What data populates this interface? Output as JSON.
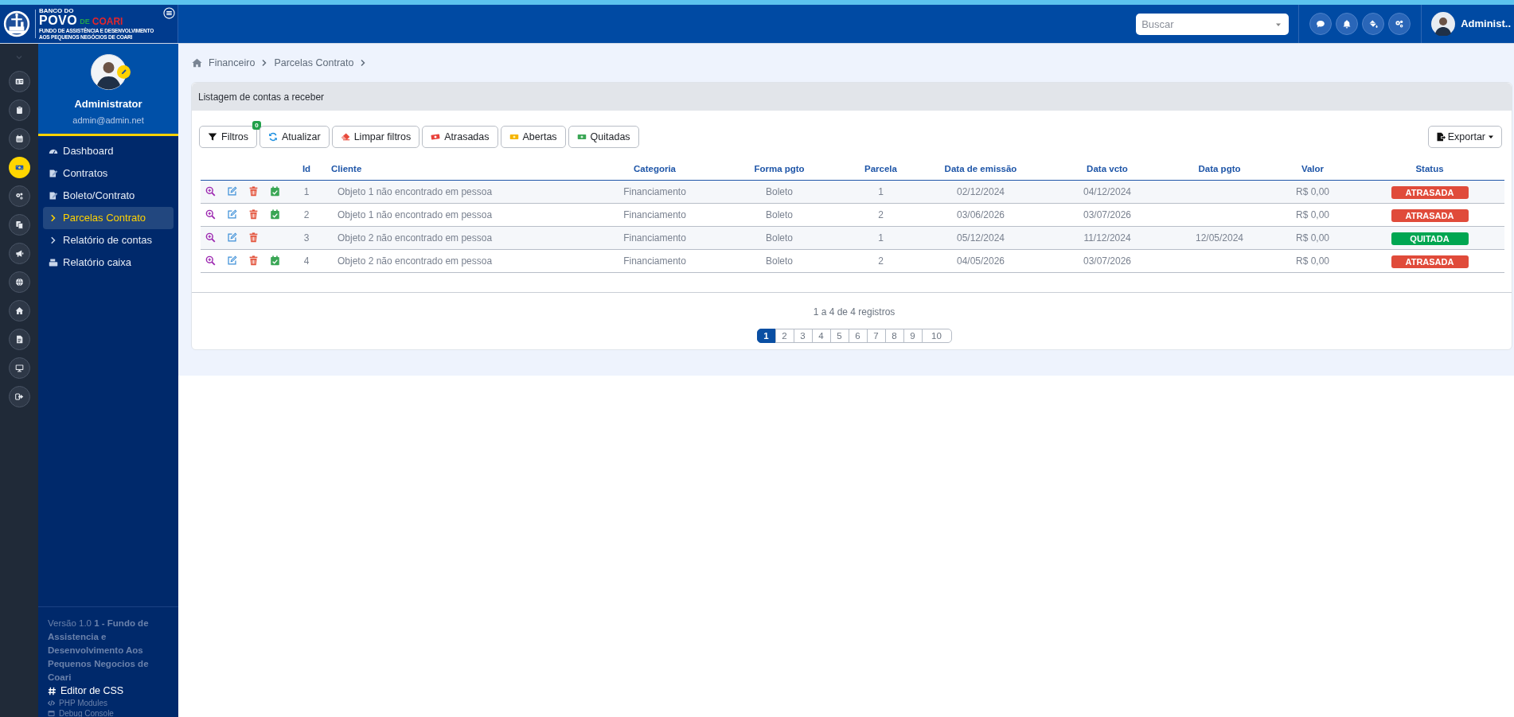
{
  "header": {
    "logo": {
      "top": "BANCO DO",
      "main": "POVO",
      "accent_1": "DE",
      "accent_2": "COARI",
      "sub_1": "FUNDO DE ASSISTÊNCIA E DESENVOLVIMENTO",
      "sub_2": "AOS PEQUENOS NEGÓCIOS DE COARI"
    },
    "search": {
      "placeholder": "Buscar"
    },
    "buttons": [
      {
        "kind": "chat"
      },
      {
        "kind": "bell"
      },
      {
        "kind": "paint"
      },
      {
        "kind": "gears"
      }
    ],
    "user": {
      "name": "Administ.."
    }
  },
  "rail": [
    {
      "kind": "id-card",
      "selected": false
    },
    {
      "kind": "clipboard",
      "selected": false
    },
    {
      "kind": "calendar",
      "selected": false
    },
    {
      "kind": "money",
      "selected": true
    },
    {
      "kind": "gears",
      "selected": false
    },
    {
      "kind": "copy",
      "selected": false
    },
    {
      "kind": "megaphone",
      "selected": false
    },
    {
      "kind": "globe",
      "selected": false
    },
    {
      "kind": "home",
      "selected": false
    },
    {
      "kind": "file",
      "selected": false
    },
    {
      "kind": "monitor",
      "selected": false
    },
    {
      "kind": "sign-out",
      "selected": false
    }
  ],
  "sidebar": {
    "profile": {
      "name": "Administrator",
      "email": "admin@admin.net"
    },
    "items": [
      {
        "kind": "gauge",
        "label": "Dashboard",
        "selected": false
      },
      {
        "kind": "document",
        "label": "Contratos",
        "selected": false
      },
      {
        "kind": "document",
        "label": "Boleto/Contrato",
        "selected": false
      },
      {
        "kind": "chevron",
        "label": "Parcelas Contrato",
        "selected": true
      },
      {
        "kind": "chevron",
        "label": "Relatório de contas",
        "selected": false
      },
      {
        "kind": "register",
        "label": "Relatório caixa",
        "selected": false
      }
    ],
    "footer": {
      "version": "Versão 1.0 **1 - Fundo de Assistencia e Desenvolvimento Aos Pequenos Negocios de Coari**",
      "links": [
        {
          "kind": "hash",
          "label": "Editor de CSS"
        },
        {
          "kind": "code",
          "label": "PHP Modules"
        },
        {
          "kind": "console",
          "label": "Debug Console"
        }
      ]
    }
  },
  "breadcrumb": [
    "Financeiro",
    "Parcelas Contrato"
  ],
  "card": {
    "title": "Listagem de contas a receber",
    "toolbar": [
      {
        "kind": "filter",
        "label": "Filtros",
        "badge": "0"
      },
      {
        "kind": "refresh",
        "label": "Atualizar"
      },
      {
        "kind": "eraser",
        "label": "Limpar filtros"
      },
      {
        "kind": "overdue",
        "label": "Atrasadas"
      },
      {
        "kind": "open",
        "label": "Abertas"
      },
      {
        "kind": "paid",
        "label": "Quitadas"
      }
    ],
    "export": "Exportar",
    "table": {
      "columns": [
        "Id",
        "Cliente",
        "Categoria",
        "Forma pgto",
        "Parcela",
        "Data de emissão",
        "Data vcto",
        "Data pgto",
        "Valor",
        "Status"
      ],
      "rows": [
        {
          "actions": [
            {
              "kind": "view"
            },
            {
              "kind": "edit"
            },
            {
              "kind": "delete"
            },
            {
              "kind": "pay"
            }
          ],
          "cells": [
            "1",
            "Objeto 1 não encontrado em pessoa",
            "Financiamento",
            "Boleto",
            "1",
            "02/12/2024",
            "04/12/2024",
            "",
            "R$ 0,00"
          ],
          "status": {
            "label": "ATRASADA",
            "color": "#e04b3a"
          }
        },
        {
          "actions": [
            {
              "kind": "view"
            },
            {
              "kind": "edit"
            },
            {
              "kind": "delete"
            },
            {
              "kind": "pay"
            }
          ],
          "cells": [
            "2",
            "Objeto 1 não encontrado em pessoa",
            "Financiamento",
            "Boleto",
            "2",
            "03/06/2026",
            "03/07/2026",
            "",
            "R$ 0,00"
          ],
          "status": {
            "label": "ATRASADA",
            "color": "#e04b3a"
          }
        },
        {
          "actions": [
            {
              "kind": "view"
            },
            {
              "kind": "edit"
            },
            {
              "kind": "delete"
            }
          ],
          "cells": [
            "3",
            "Objeto 2 não encontrado em pessoa",
            "Financiamento",
            "Boleto",
            "1",
            "05/12/2024",
            "11/12/2024",
            "12/05/2024",
            "R$ 0,00"
          ],
          "status": {
            "label": "QUITADA",
            "color": "#00a651"
          }
        },
        {
          "actions": [
            {
              "kind": "view"
            },
            {
              "kind": "edit"
            },
            {
              "kind": "delete"
            },
            {
              "kind": "pay"
            }
          ],
          "cells": [
            "4",
            "Objeto 2 não encontrado em pessoa",
            "Financiamento",
            "Boleto",
            "2",
            "04/05/2026",
            "03/07/2026",
            "",
            "R$ 0,00"
          ],
          "status": {
            "label": "ATRASADA",
            "color": "#e04b3a"
          }
        }
      ]
    },
    "info": "1 a 4 de 4 registros",
    "pages": [
      {
        "label": "1",
        "selected": true
      },
      {
        "label": "2",
        "selected": false
      },
      {
        "label": "3",
        "selected": false
      },
      {
        "label": "4",
        "selected": false
      },
      {
        "label": "5",
        "selected": false
      },
      {
        "label": "6",
        "selected": false
      },
      {
        "label": "7",
        "selected": false
      },
      {
        "label": "8",
        "selected": false
      },
      {
        "label": "9",
        "selected": false
      },
      {
        "label": "10",
        "selected": false
      }
    ]
  }
}
